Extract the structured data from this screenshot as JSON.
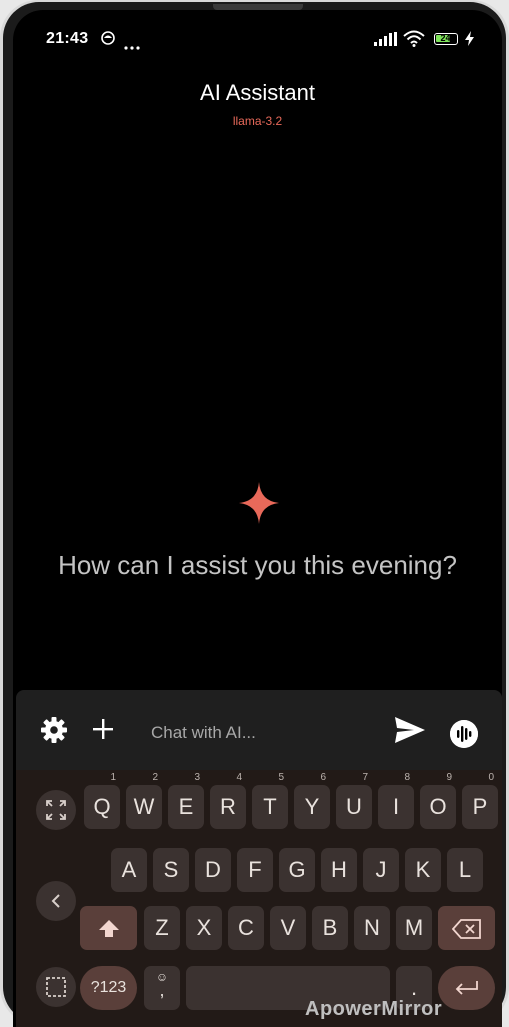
{
  "status_bar": {
    "time": "21:43",
    "battery_level": "24",
    "icons": [
      "app-notification-icon",
      "more-dots-icon",
      "signal-icon",
      "wifi-icon",
      "battery-icon",
      "charging-icon"
    ]
  },
  "header": {
    "title": "AI Assistant",
    "model": "llama-3.2"
  },
  "empty_state": {
    "icon": "sparkle-icon",
    "greeting": "How can I assist you this evening?"
  },
  "input_bar": {
    "placeholder": "Chat with AI...",
    "value": "",
    "icons": [
      "settings-icon",
      "add-icon",
      "send-icon",
      "voice-mode-icon"
    ]
  },
  "keyboard": {
    "row1": [
      {
        "key": "Q",
        "sup": "1"
      },
      {
        "key": "W",
        "sup": "2"
      },
      {
        "key": "E",
        "sup": "3"
      },
      {
        "key": "R",
        "sup": "4"
      },
      {
        "key": "T",
        "sup": "5"
      },
      {
        "key": "Y",
        "sup": "6"
      },
      {
        "key": "U",
        "sup": "7"
      },
      {
        "key": "I",
        "sup": "8"
      },
      {
        "key": "O",
        "sup": "9"
      },
      {
        "key": "P",
        "sup": "0"
      }
    ],
    "row2": [
      "A",
      "S",
      "D",
      "F",
      "G",
      "H",
      "J",
      "K",
      "L"
    ],
    "row3": [
      "Z",
      "X",
      "C",
      "V",
      "B",
      "N",
      "M"
    ],
    "symbols_label": "?123",
    "comma": ",",
    "period": "."
  },
  "colors": {
    "accent": "#e8695a",
    "background": "#000000",
    "keyboard_bg": "#221a17",
    "key_bg": "#3b3230",
    "action_key_bg": "#5a3f3a"
  },
  "watermark": "ApowerMirror"
}
